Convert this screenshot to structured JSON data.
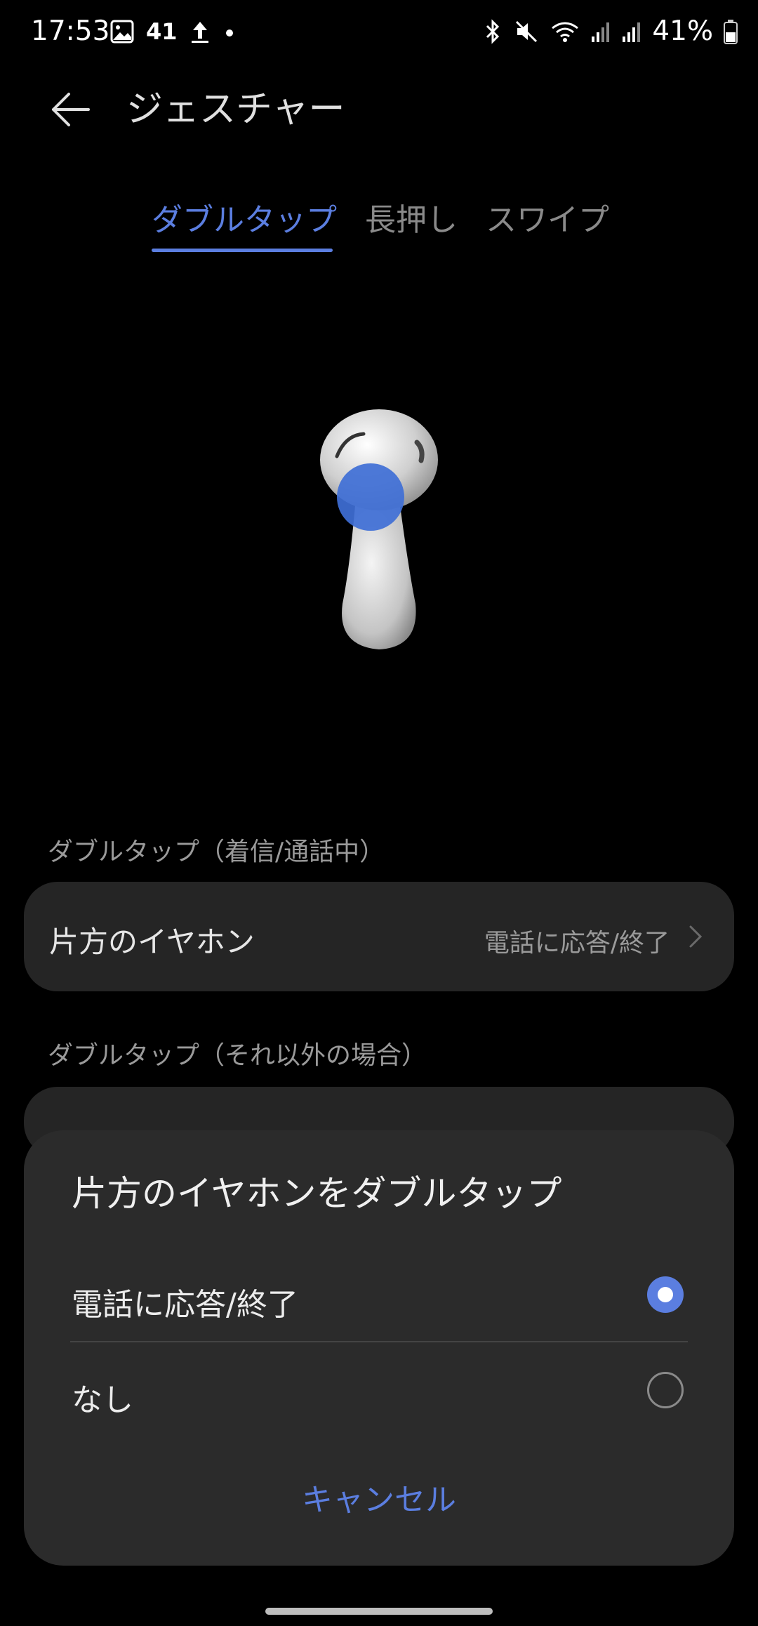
{
  "status_bar": {
    "time": "17:53",
    "notif_count": "41",
    "battery": "41%",
    "icons_left": [
      "image-icon",
      "upload-icon",
      "dot-icon"
    ],
    "icons_right": [
      "bluetooth-icon",
      "mute-icon",
      "wifi-icon",
      "signal-icon",
      "signal-icon",
      "battery-icon"
    ]
  },
  "header": {
    "title": "ジェスチャー"
  },
  "tabs": [
    {
      "label": "ダブルタップ",
      "active": true
    },
    {
      "label": "長押し",
      "active": false
    },
    {
      "label": "スワイプ",
      "active": false
    }
  ],
  "sections": [
    {
      "label": "ダブルタップ（着信/通話中）",
      "rows": [
        {
          "label": "片方のイヤホン",
          "value": "電話に応答/終了"
        }
      ]
    },
    {
      "label": "ダブルタップ（それ以外の場合）"
    }
  ],
  "dialog": {
    "title": "片方のイヤホンをダブルタップ",
    "options": [
      {
        "label": "電話に応答/終了",
        "selected": true
      },
      {
        "label": "なし",
        "selected": false
      }
    ],
    "cancel_label": "キャンセル"
  },
  "colors": {
    "accent": "#5b7ee0",
    "background": "#000000",
    "card": "#252525",
    "sheet": "#2b2b2b"
  }
}
